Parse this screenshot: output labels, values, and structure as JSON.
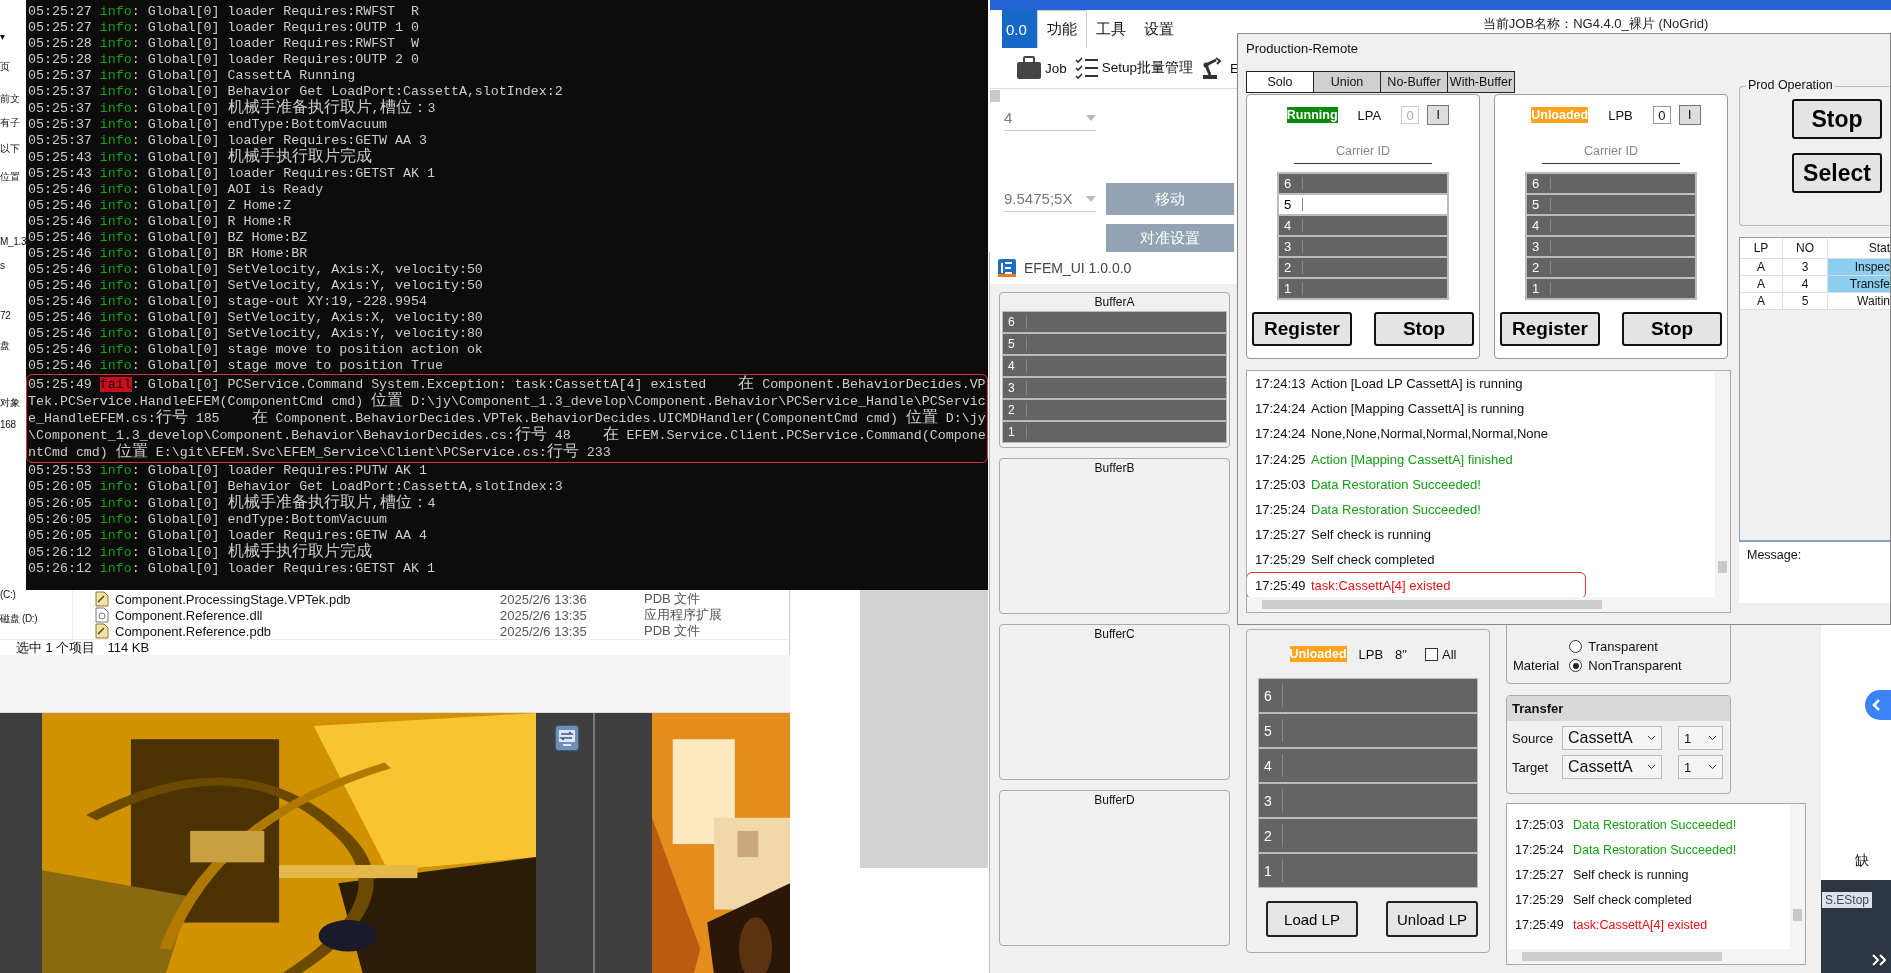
{
  "explorer": {
    "sidebar": [
      "▾",
      "页",
      "前文",
      "有子",
      "以下",
      "位置",
      "M_1.3",
      "s",
      "72",
      "盘",
      "对象",
      "168",
      "(C:)",
      "磁盘 (D:)"
    ],
    "files": [
      {
        "name": "Component.ProcessingStage.VPTek.pdb",
        "date": "2025/2/6 13:36",
        "type": "PDB 文件",
        "kind": "pdb"
      },
      {
        "name": "Component.Reference.dll",
        "date": "2025/2/6 13:35",
        "type": "应用程序扩展",
        "kind": "dll"
      },
      {
        "name": "Component.Reference.pdb",
        "date": "2025/2/6 13:35",
        "type": "PDB 文件",
        "kind": "pdb"
      }
    ],
    "status": "选中 1 个项目",
    "size": "114 KB"
  },
  "main_app": {
    "tabs": [
      {
        "label": "0.0",
        "kind": "menu",
        "selected": false
      },
      {
        "label": "功能",
        "kind": "tab",
        "selected": true
      },
      {
        "label": "工具",
        "kind": "tab",
        "selected": false
      },
      {
        "label": "设置",
        "kind": "tab",
        "selected": false
      }
    ],
    "job_title": "当前JOB名称：NG4.4.0_裸片 (NoGrid)",
    "toolbar": [
      {
        "label": "Job",
        "kind": "job"
      },
      {
        "label": "Setup批量管理",
        "kind": "setup"
      },
      {
        "label": "E",
        "kind": "robot"
      }
    ],
    "dropdowns": [
      "4",
      "9.5475;5X"
    ],
    "buttons": [
      "移动",
      "对准设置"
    ],
    "side_text": "缺",
    "estop": "S.EStop"
  },
  "console": {
    "lines": [
      {
        "time": "05:25:27",
        "level": "info",
        "text": ": Global[0] loader Requires:RWFST  R",
        "annotated": false
      },
      {
        "time": "05:25:27",
        "level": "info",
        "text": ": Global[0] loader Requires:OUTP 1 0",
        "annotated": false
      },
      {
        "time": "05:25:28",
        "level": "info",
        "text": ": Global[0] loader Requires:RWFST  W",
        "annotated": false
      },
      {
        "time": "05:25:28",
        "level": "info",
        "text": ": Global[0] loader Requires:OUTP 2 0",
        "annotated": false
      },
      {
        "time": "05:25:37",
        "level": "info",
        "text": ": Global[0] CassettA Running",
        "annotated": false
      },
      {
        "time": "05:25:37",
        "level": "info",
        "text": ": Global[0] Behavior Get LoadPort:CassettA,slotIndex:2",
        "annotated": false
      },
      {
        "time": "05:25:37",
        "level": "info",
        "text": ": Global[0] 机械手准备执行取片,槽位：3",
        "annotated": false
      },
      {
        "time": "05:25:37",
        "level": "info",
        "text": ": Global[0] endType:BottomVacuum",
        "annotated": false
      },
      {
        "time": "05:25:37",
        "level": "info",
        "text": ": Global[0] loader Requires:GETW AA 3",
        "annotated": false
      },
      {
        "time": "05:25:43",
        "level": "info",
        "text": ": Global[0] 机械手执行取片完成",
        "annotated": false
      },
      {
        "time": "05:25:43",
        "level": "info",
        "text": ": Global[0] loader Requires:GETST AK 1",
        "annotated": false
      },
      {
        "time": "05:25:46",
        "level": "info",
        "text": ": Global[0] AOI is Ready",
        "annotated": false
      },
      {
        "time": "05:25:46",
        "level": "info",
        "text": ": Global[0] Z Home:Z",
        "annotated": false
      },
      {
        "time": "05:25:46",
        "level": "info",
        "text": ": Global[0] R Home:R",
        "annotated": false
      },
      {
        "time": "05:25:46",
        "level": "info",
        "text": ": Global[0] BZ Home:BZ",
        "annotated": false
      },
      {
        "time": "05:25:46",
        "level": "info",
        "text": ": Global[0] BR Home:BR",
        "annotated": false
      },
      {
        "time": "05:25:46",
        "level": "info",
        "text": ": Global[0] SetVelocity, Axis:X, velocity:50",
        "annotated": false
      },
      {
        "time": "05:25:46",
        "level": "info",
        "text": ": Global[0] SetVelocity, Axis:Y, velocity:50",
        "annotated": false
      },
      {
        "time": "05:25:46",
        "level": "info",
        "text": ": Global[0] stage-out XY:19,-228.9954",
        "annotated": false
      },
      {
        "time": "05:25:46",
        "level": "info",
        "text": ": Global[0] SetVelocity, Axis:X, velocity:80",
        "annotated": false
      },
      {
        "time": "05:25:46",
        "level": "info",
        "text": ": Global[0] SetVelocity, Axis:Y, velocity:80",
        "annotated": false
      },
      {
        "time": "05:25:46",
        "level": "info",
        "text": ": Global[0] stage move to position action ok",
        "annotated": false
      },
      {
        "time": "05:25:46",
        "level": "info",
        "text": ": Global[0] stage move to position True",
        "annotated": false
      },
      {
        "time": "05:25:49",
        "level": "fail",
        "text": ": Global[0] PCService.Command System.Exception: task:CassettA[4] existed    在 Component.BehaviorDecides.VPTek.PCService.HandleEFEM(ComponentCmd cmd) 位置 D:\\jy\\Component_1.3_develop\\Component.Behavior\\PCService_Handle\\PCService_HandleEFEM.cs:行号 185    在 Component.BehaviorDecides.VPTek.BehaviorDecides.UICMDHandler(ComponentCmd cmd) 位置 D:\\jy\\Component_1.3_develop\\Component.Behavior\\BehaviorDecides.cs:行号 48    在 EFEM.Service.Client.PCService.Command(ComponentCmd cmd) 位置 E:\\git\\EFEM.Svc\\EFEM_Service\\Client\\PCService.cs:行号 233",
        "annotated": true
      },
      {
        "time": "05:25:53",
        "level": "info",
        "text": ": Global[0] loader Requires:PUTW AK 1",
        "annotated": false
      },
      {
        "time": "05:26:05",
        "level": "info",
        "text": ": Global[0] Behavior Get LoadPort:CassettA,slotIndex:3",
        "annotated": false
      },
      {
        "time": "05:26:05",
        "level": "info",
        "text": ": Global[0] 机械手准备执行取片,槽位：4",
        "annotated": false
      },
      {
        "time": "05:26:05",
        "level": "info",
        "text": ": Global[0] endType:BottomVacuum",
        "annotated": false
      },
      {
        "time": "05:26:05",
        "level": "info",
        "text": ": Global[0] loader Requires:GETW AA 4",
        "annotated": false
      },
      {
        "time": "05:26:12",
        "level": "info",
        "text": ": Global[0] 机械手执行取片完成",
        "annotated": false
      },
      {
        "time": "05:26:12",
        "level": "info",
        "text": ": Global[0] loader Requires:GETST AK 1",
        "annotated": false
      }
    ]
  },
  "efem_ui": {
    "title": "EFEM_UI 1.0.0.0",
    "buffers": [
      {
        "name": "BufferA",
        "slots": [
          "6",
          "5",
          "4",
          "3",
          "2",
          "1"
        ]
      },
      {
        "name": "BufferB"
      },
      {
        "name": "BufferC"
      },
      {
        "name": "BufferD"
      }
    ],
    "load_port": {
      "status": "Unloaded",
      "kind": "unloaded",
      "name": "LPB",
      "size": "8\"",
      "all_label": "All",
      "all_checked": false,
      "slots": [
        "6",
        "5",
        "4",
        "3",
        "2",
        "1"
      ],
      "buttons": [
        "Load LP",
        "Unload LP"
      ]
    },
    "material": {
      "label": "Material",
      "options": [
        {
          "label": "Transparent",
          "selected": false
        },
        {
          "label": "NonTransparent",
          "selected": true
        }
      ]
    },
    "transfer": {
      "title": "Transfer",
      "rows": [
        {
          "label": "Source",
          "value": "CassettA",
          "slot": "1"
        },
        {
          "label": "Target",
          "value": "CassettA",
          "slot": "1"
        }
      ]
    },
    "log": [
      {
        "time": "17:25:03",
        "text": "Data Restoration Succeeded!",
        "kind": "success",
        "annotated": false
      },
      {
        "time": "17:25:24",
        "text": "Data Restoration Succeeded!",
        "kind": "success",
        "annotated": false
      },
      {
        "time": "17:25:27",
        "text": "Self check is running",
        "kind": "info",
        "annotated": false
      },
      {
        "time": "17:25:29",
        "text": "Self check completed",
        "kind": "info",
        "annotated": false
      },
      {
        "time": "17:25:49",
        "text": "task:CassettA[4] existed",
        "kind": "error",
        "annotated": false
      }
    ]
  },
  "production_remote": {
    "title": "Production-Remote",
    "tabs": [
      {
        "label": "Solo",
        "selected": true
      },
      {
        "label": "Union",
        "selected": false
      },
      {
        "label": "No-Buffer",
        "selected": false
      },
      {
        "label": "With-Buffer",
        "selected": false
      }
    ],
    "load_ports": [
      {
        "status": "Running",
        "kind": "running",
        "name": "LPA",
        "count": "0",
        "count_disabled": true,
        "button": "I",
        "carrier_label": "Carrier ID",
        "slots": [
          {
            "label": "6",
            "selected": false
          },
          {
            "label": "5",
            "selected": true
          },
          {
            "label": "4",
            "selected": false
          },
          {
            "label": "3",
            "selected": false
          },
          {
            "label": "2",
            "selected": false
          },
          {
            "label": "1",
            "selected": false
          }
        ],
        "buttons": [
          "Register",
          "Stop"
        ]
      },
      {
        "status": "Unloaded",
        "kind": "unloaded",
        "name": "LPB",
        "count": "0",
        "count_disabled": false,
        "button": "I",
        "carrier_label": "Carrier ID",
        "slots": [
          {
            "label": "6",
            "selected": false
          },
          {
            "label": "5",
            "selected": false
          },
          {
            "label": "4",
            "selected": false
          },
          {
            "label": "3",
            "selected": false
          },
          {
            "label": "2",
            "selected": false
          },
          {
            "label": "1",
            "selected": false
          }
        ],
        "buttons": [
          "Register",
          "Stop"
        ]
      }
    ],
    "prod_operation": {
      "title": "Prod Operation",
      "buttons": [
        "Stop",
        "Select"
      ]
    },
    "table": {
      "columns": [
        "LP",
        "NO",
        "Stat"
      ],
      "rows": [
        {
          "cells": [
            "A",
            "3",
            "Inspec"
          ],
          "highlighted": true
        },
        {
          "cells": [
            "A",
            "4",
            "Transfe"
          ],
          "highlighted": true
        },
        {
          "cells": [
            "A",
            "5",
            "Waitin"
          ],
          "highlighted": false
        }
      ]
    },
    "message_label": "Message:",
    "log": [
      {
        "time": "17:24:13",
        "text": "Action [Load LP CassettA] is running",
        "kind": "info",
        "annotated": false
      },
      {
        "time": "17:24:24",
        "text": "Action [Mapping CassettA] is running",
        "kind": "info",
        "annotated": false
      },
      {
        "time": "17:24:24",
        "text": "None,None,Normal,Normal,Normal,None",
        "kind": "info",
        "annotated": false
      },
      {
        "time": "17:24:25",
        "text": "Action [Mapping CassettA] finished",
        "kind": "success",
        "annotated": false
      },
      {
        "time": "17:25:03",
        "text": "Data Restoration Succeeded!",
        "kind": "success",
        "annotated": false
      },
      {
        "time": "17:25:24",
        "text": "Data Restoration Succeeded!",
        "kind": "success",
        "annotated": false
      },
      {
        "time": "17:25:27",
        "text": "Self check is running",
        "kind": "info",
        "annotated": false
      },
      {
        "time": "17:25:29",
        "text": "Self check completed",
        "kind": "info",
        "annotated": false
      },
      {
        "time": "17:25:49",
        "text": "task:CassettA[4] existed",
        "kind": "error",
        "annotated": true
      }
    ]
  }
}
